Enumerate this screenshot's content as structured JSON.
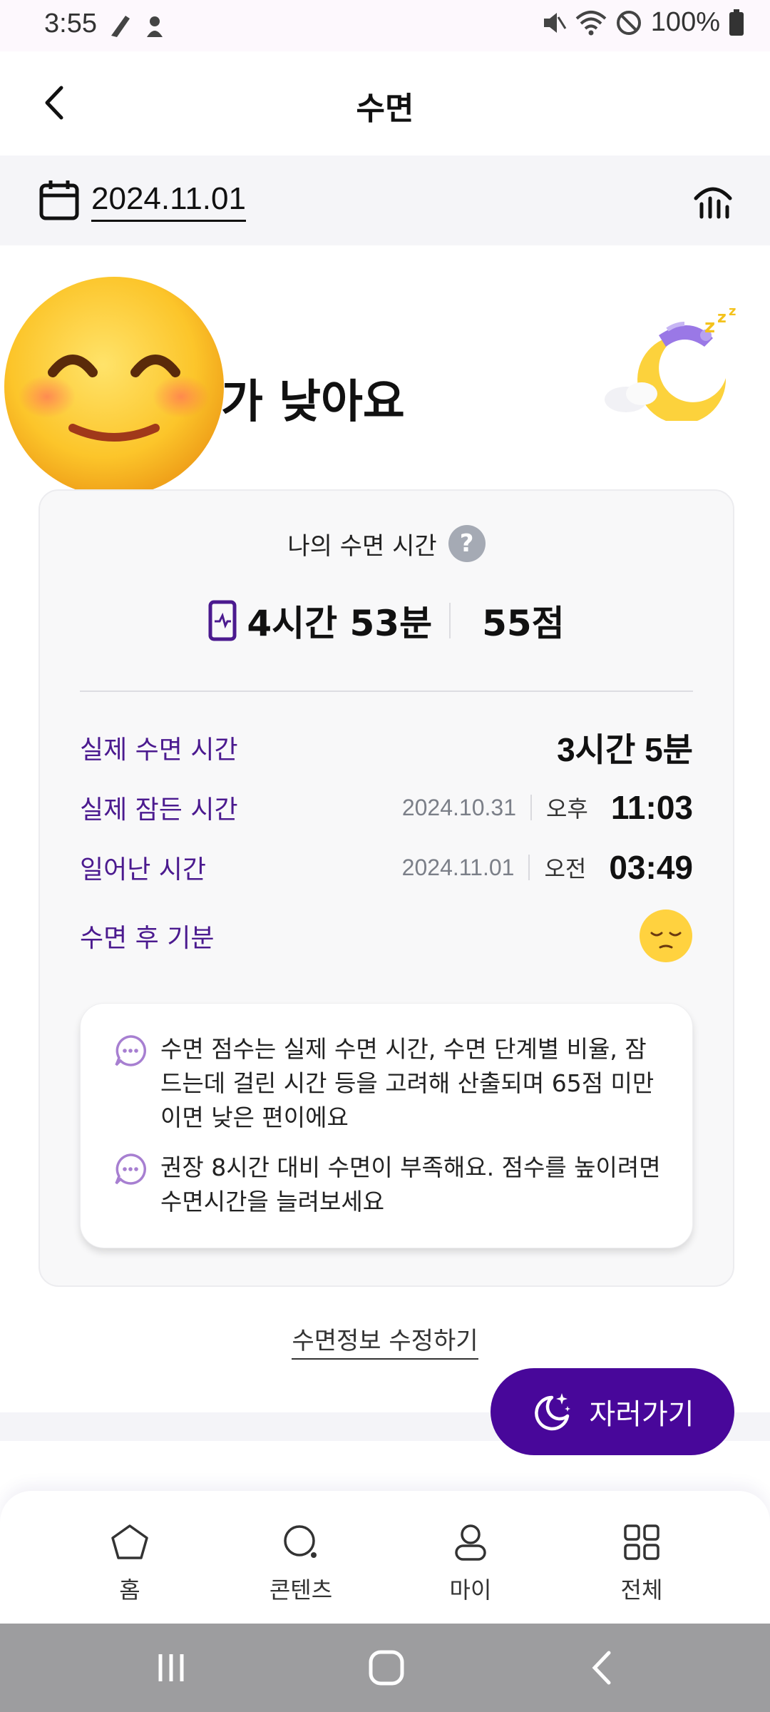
{
  "status_bar": {
    "time": "3:55",
    "battery": "100%"
  },
  "header": {
    "title": "수면"
  },
  "date_bar": {
    "date": "2024.11.01"
  },
  "score": {
    "headline": "가 낮아요"
  },
  "card": {
    "title": "나의 수면 시간",
    "help": "?",
    "total_time": "4시간 53분",
    "total_score": "55점",
    "rows": [
      {
        "label": "실제 수면 시간",
        "value": "3시간 5분"
      },
      {
        "label": "실제 잠든 시간",
        "date": "2024.10.31",
        "ampm": "오후",
        "time": "11:03"
      },
      {
        "label": "일어난 시간",
        "date": "2024.11.01",
        "ampm": "오전",
        "time": "03:49"
      },
      {
        "label": "수면 후 기분"
      }
    ],
    "tips": [
      "수면 점수는 실제 수면 시간, 수면 단계별 비율, 잠드는데 걸린 시간 등을 고려해 산출되며 65점 미만이면 낮은 편이에요",
      "권장 8시간 대비 수면이 부족해요. 점수를 높이려면 수면시간을 늘려보세요"
    ]
  },
  "edit_link": "수면정보 수정하기",
  "sleep_button": "자러가기",
  "bottom_nav": [
    {
      "label": "홈",
      "icon": "home-icon"
    },
    {
      "label": "콘텐츠",
      "icon": "search-icon"
    },
    {
      "label": "마이",
      "icon": "person-icon"
    },
    {
      "label": "전체",
      "icon": "grid-icon"
    }
  ],
  "colors": {
    "accent": "#48079a",
    "label_purple": "#4b1a8f",
    "emoji_yellow": "#ffd23f"
  }
}
